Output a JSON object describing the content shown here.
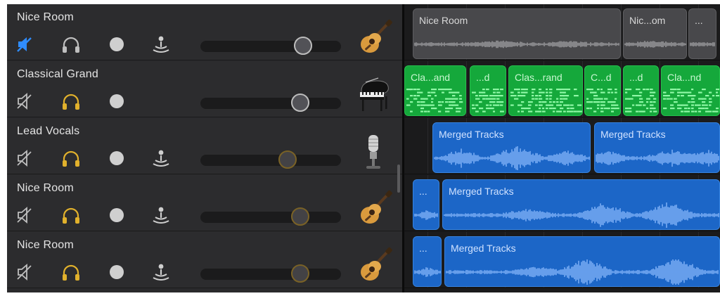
{
  "tracks": [
    {
      "name": "Nice Room",
      "muted": true,
      "solo": false,
      "has_input_monitor": true,
      "volume": 0.73,
      "instrument": "acoustic-guitar-icon"
    },
    {
      "name": "Classical Grand",
      "muted": false,
      "solo": true,
      "has_input_monitor": false,
      "volume": 0.71,
      "instrument": "grand-piano-icon"
    },
    {
      "name": "Lead Vocals",
      "muted": false,
      "solo": true,
      "has_input_monitor": true,
      "volume": 0.62,
      "instrument": "microphone-icon"
    },
    {
      "name": "Nice Room",
      "muted": false,
      "solo": true,
      "has_input_monitor": true,
      "volume": 0.71,
      "instrument": "acoustic-guitar-icon"
    },
    {
      "name": "Nice Room",
      "muted": false,
      "solo": true,
      "has_input_monitor": true,
      "volume": 0.71,
      "instrument": "acoustic-guitar-icon"
    }
  ],
  "lanes": [
    {
      "regions": [
        {
          "label": "Nice Room",
          "color": "gray"
        },
        {
          "label": "Nic...om",
          "color": "gray"
        },
        {
          "label": "...",
          "color": "gray"
        }
      ]
    },
    {
      "regions": [
        {
          "label": "Cla...and",
          "color": "green"
        },
        {
          "label": "...d",
          "color": "green"
        },
        {
          "label": "Clas...rand",
          "color": "green"
        },
        {
          "label": "C...d",
          "color": "green"
        },
        {
          "label": "...d",
          "color": "green"
        },
        {
          "label": "Cla...nd",
          "color": "green"
        }
      ]
    },
    {
      "regions": [
        {
          "label": "Merged Tracks",
          "color": "blue"
        },
        {
          "label": "Merged Tracks",
          "color": "blue"
        }
      ]
    },
    {
      "regions": [
        {
          "label": "...",
          "color": "blue"
        },
        {
          "label": "Merged Tracks",
          "color": "blue"
        }
      ]
    },
    {
      "regions": [
        {
          "label": "...",
          "color": "blue"
        },
        {
          "label": "Merged Tracks",
          "color": "blue"
        }
      ]
    }
  ],
  "colors": {
    "mute_active": "#2f8cff",
    "solo_active": "#e1b12c",
    "icon_inactive": "#bfbfbf",
    "region_gray": "#48484b",
    "region_green": "#15a83b",
    "region_blue": "#1c66c7"
  }
}
